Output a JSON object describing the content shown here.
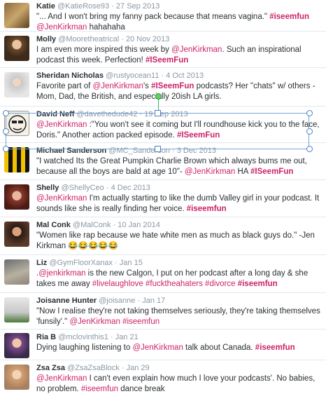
{
  "tweets": [
    {
      "name": "Katie",
      "handle": "@KatieRose93",
      "date": "27 Sep 2013",
      "lines": [
        [
          [
            "t",
            "\"... And I won't bring my fanny pack because that means vagina.\" "
          ],
          [
            "h",
            "#iseemfun"
          ]
        ],
        [
          [
            "m",
            "@JenKirkman"
          ],
          [
            "t",
            " hahahaha"
          ]
        ]
      ]
    },
    {
      "name": "Molly",
      "handle": "@Mooretheatrical",
      "date": "20 Nov 2013",
      "lines": [
        [
          [
            "t",
            "I am even more inspired this week by "
          ],
          [
            "m",
            "@JenKirkman"
          ],
          [
            "t",
            ". Such an inspirational"
          ]
        ],
        [
          [
            "t",
            "podcast this week. Perfection! "
          ],
          [
            "h",
            "#ISeemFun"
          ]
        ]
      ]
    },
    {
      "name": "Sheridan Nicholas",
      "handle": "@rustyocean11",
      "date": "4 Oct 2013",
      "lines": [
        [
          [
            "t",
            "Favorite part of "
          ],
          [
            "m",
            "@JenKirkman"
          ],
          [
            "t",
            "'s "
          ],
          [
            "h",
            "#ISeemFun"
          ],
          [
            "t",
            " podcasts? Her \"chats\" w/ others -"
          ]
        ],
        [
          [
            "t",
            "Mom, Dad, the British, and especially 20ish LA girls."
          ]
        ]
      ]
    },
    {
      "name": "David Neff",
      "handle": "@davethedude42",
      "date": "19 Sep 2013",
      "lines": [
        [
          [
            "m",
            "@JenKirkman"
          ],
          [
            "t",
            " :\"You won't see it coming but I'll roundhouse kick you to the face,"
          ]
        ],
        [
          [
            "t",
            "Doris.\" Another action packed episode. "
          ],
          [
            "h",
            "#ISeemFun"
          ]
        ]
      ]
    },
    {
      "name": "Michael Sanderson",
      "handle": "@MC_Sanderson",
      "date": "3 Dec 2013",
      "lines": [
        [
          [
            "t",
            "\"I watched Its the Great Pumpkin Charlie Brown which always bums me out,"
          ]
        ],
        [
          [
            "t",
            "because all the boys are bald at age 10\"- "
          ],
          [
            "m",
            "@JenKirkman"
          ],
          [
            "t",
            " HA "
          ],
          [
            "h",
            "#ISeemFun"
          ]
        ]
      ]
    },
    {
      "name": "Shelly",
      "handle": "@ShellyCeo",
      "date": "4 Dec 2013",
      "lines": [
        [
          [
            "m",
            "@JenKirkman"
          ],
          [
            "t",
            " I'm actually starting to like  the dumb Valley girl in your podcast. It"
          ]
        ],
        [
          [
            "t",
            "sounds like she is really finding her voice. "
          ],
          [
            "h",
            "#iseemfun"
          ]
        ]
      ]
    },
    {
      "name": "Mal Conk",
      "handle": "@MalConk",
      "date": "10 Jan 2014",
      "lines": [
        [
          [
            "t",
            "\"Women like rap because we hate white men as much as black guys do.\" -Jen"
          ]
        ],
        [
          [
            "t",
            "Kirkman 😂😂😂😂😂"
          ]
        ]
      ]
    },
    {
      "name": "Liz",
      "handle": "@GymFloorXanax",
      "date": "Jan 15",
      "lines": [
        [
          [
            "t",
            "."
          ],
          [
            "m",
            "@jenkirkman"
          ],
          [
            "t",
            " is the new Calgon, I put on her podcast after a long day & she"
          ]
        ],
        [
          [
            "t",
            "takes me away "
          ],
          [
            "m",
            "#livelaughlove"
          ],
          [
            "t",
            " "
          ],
          [
            "m",
            "#fucktheahaters"
          ],
          [
            "t",
            " "
          ],
          [
            "m",
            "#divorce"
          ],
          [
            "t",
            " "
          ],
          [
            "h",
            "#iseemfun"
          ]
        ]
      ]
    },
    {
      "name": "Joisanne Hunter",
      "handle": "@joisanne",
      "date": "Jan 17",
      "lines": [
        [
          [
            "t",
            "\"Now I realise they're not taking themselves seriously, they're taking themselves"
          ]
        ],
        [
          [
            "t",
            "'funsily'.\" "
          ],
          [
            "m",
            "@JenKirkman"
          ],
          [
            "t",
            " "
          ],
          [
            "m",
            "#iseemfun"
          ]
        ]
      ]
    },
    {
      "name": "Ria B",
      "handle": "@mclovinthis1",
      "date": "Jan 21",
      "lines": [
        [
          [
            "t",
            "Dying laughing listening to "
          ],
          [
            "m",
            "@JenKirkman"
          ],
          [
            "t",
            " talk about Canada. "
          ],
          [
            "h",
            "#iseemfun"
          ]
        ]
      ]
    },
    {
      "name": "Zsa Zsa",
      "handle": "@ZsaZsaBlock",
      "date": "Jan 29",
      "lines": [
        [
          [
            "m",
            "@JenKirkman"
          ],
          [
            "t",
            " I can't even explain how much I love your podcasts'. No babies,"
          ]
        ],
        [
          [
            "t",
            "no problem. "
          ],
          [
            "m",
            "#iseemfun"
          ],
          [
            "t",
            " dance break"
          ]
        ]
      ]
    }
  ],
  "separator": "·",
  "colors": {
    "link": "#cc2268",
    "name": "#292f33",
    "meta": "#8899a6",
    "selection": "#4a7fc0",
    "rotate_handle": "#5bd65b"
  }
}
